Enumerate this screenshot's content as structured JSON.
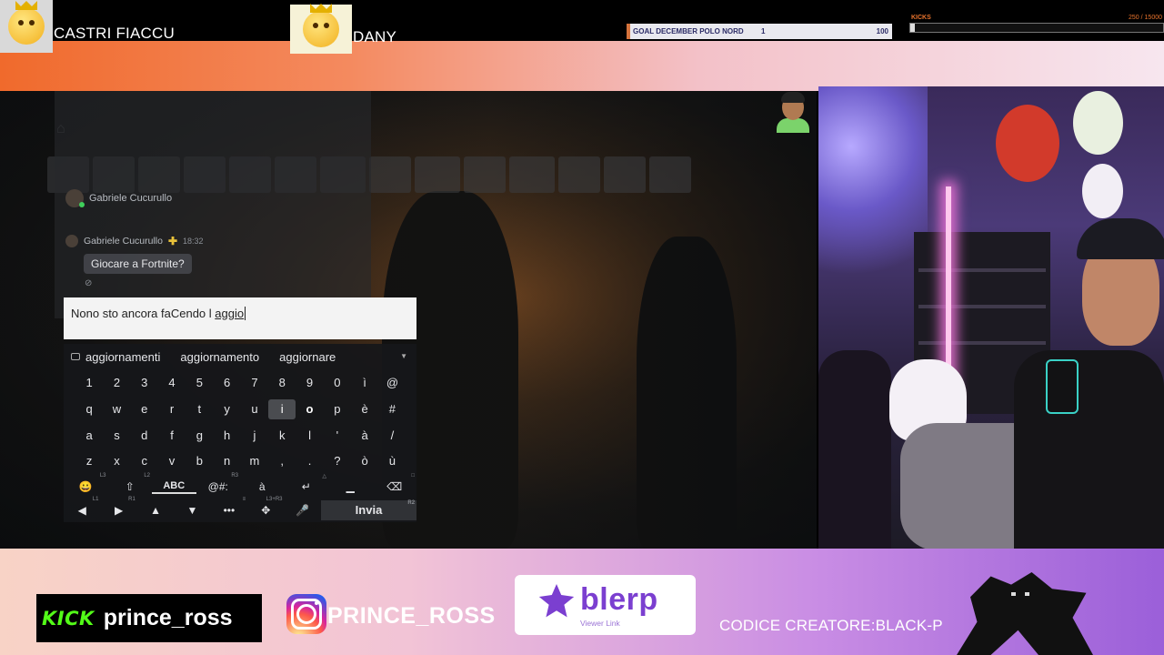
{
  "overlay": {
    "mods": [
      {
        "name": "CASTRI FIACCU"
      },
      {
        "name": "DANY"
      }
    ],
    "goal": {
      "label": "GOAL DECEMBER POLO NORD",
      "current": "1",
      "target": "100"
    },
    "kicks": {
      "label": "KICKS",
      "count": "250  / 15000",
      "progress": 0.0167
    }
  },
  "chat": {
    "header_name": "Gabriele Cucurullo",
    "message": {
      "author": "Gabriele Cucurullo",
      "plus_badge": "✚",
      "time": "18:32",
      "text": "Giocare a Fortnite?"
    },
    "reaction_icon": "⊘",
    "compose": {
      "typed": "Nono sto ancora faCendo l ",
      "current_word": "aggio"
    }
  },
  "keyboard": {
    "suggestions": [
      "aggiornamenti",
      "aggiornamento",
      "aggiornare"
    ],
    "rows": [
      [
        "1",
        "2",
        "3",
        "4",
        "5",
        "6",
        "7",
        "8",
        "9",
        "0",
        "ì",
        "@"
      ],
      [
        "q",
        "w",
        "e",
        "r",
        "t",
        "y",
        "u",
        "i",
        "o",
        "p",
        "è",
        "#"
      ],
      [
        "a",
        "s",
        "d",
        "f",
        "g",
        "h",
        "j",
        "k",
        "l",
        "'",
        "à",
        "/"
      ],
      [
        "z",
        "x",
        "c",
        "v",
        "b",
        "n",
        "m",
        ",",
        ".",
        "?",
        "ò",
        "ù"
      ]
    ],
    "highlighted_key": "i",
    "bold_key": "o",
    "function_row": [
      {
        "label": "😀",
        "hint": "L3",
        "name": "emoji-key"
      },
      {
        "label": "⇧",
        "hint": "L2",
        "name": "shift-key"
      },
      {
        "label": "ABC",
        "hint": "",
        "name": "abc-key"
      },
      {
        "label": "@#:",
        "hint": "R3",
        "name": "symbols-key"
      },
      {
        "label": "à",
        "hint": "",
        "name": "accent-key"
      },
      {
        "label": "↵",
        "hint": "△",
        "name": "enter-key"
      },
      {
        "label": "▁",
        "hint": "",
        "name": "space-key"
      },
      {
        "label": "⌫",
        "hint": "□",
        "name": "backspace-key"
      }
    ],
    "nav_row": [
      {
        "label": "◀",
        "hint": "L1",
        "name": "left-key"
      },
      {
        "label": "▶",
        "hint": "R1",
        "name": "right-key"
      },
      {
        "label": "▲",
        "hint": "",
        "name": "up-key"
      },
      {
        "label": "▼",
        "hint": "",
        "name": "down-key"
      },
      {
        "label": "•••",
        "hint": "≡",
        "name": "more-key"
      },
      {
        "label": "✥",
        "hint": "L3+R3",
        "name": "controller-key"
      },
      {
        "label": "🎤",
        "hint": "",
        "name": "mic-key"
      }
    ],
    "send_label": "Invia",
    "send_hint": "R2"
  },
  "banner": {
    "kick_logo": "KICK",
    "kick_user": "prince_ross",
    "ig_user": "PRINCE_ROSS",
    "blerp_word": "blerp",
    "blerp_sub": "Viewer Link",
    "creator_code": "CODICE CREATORE:BLACK-P"
  },
  "colors": {
    "kick_green": "#53fc18",
    "blerp_purple": "#7b3fd0",
    "goal_accent": "#d5733c"
  }
}
